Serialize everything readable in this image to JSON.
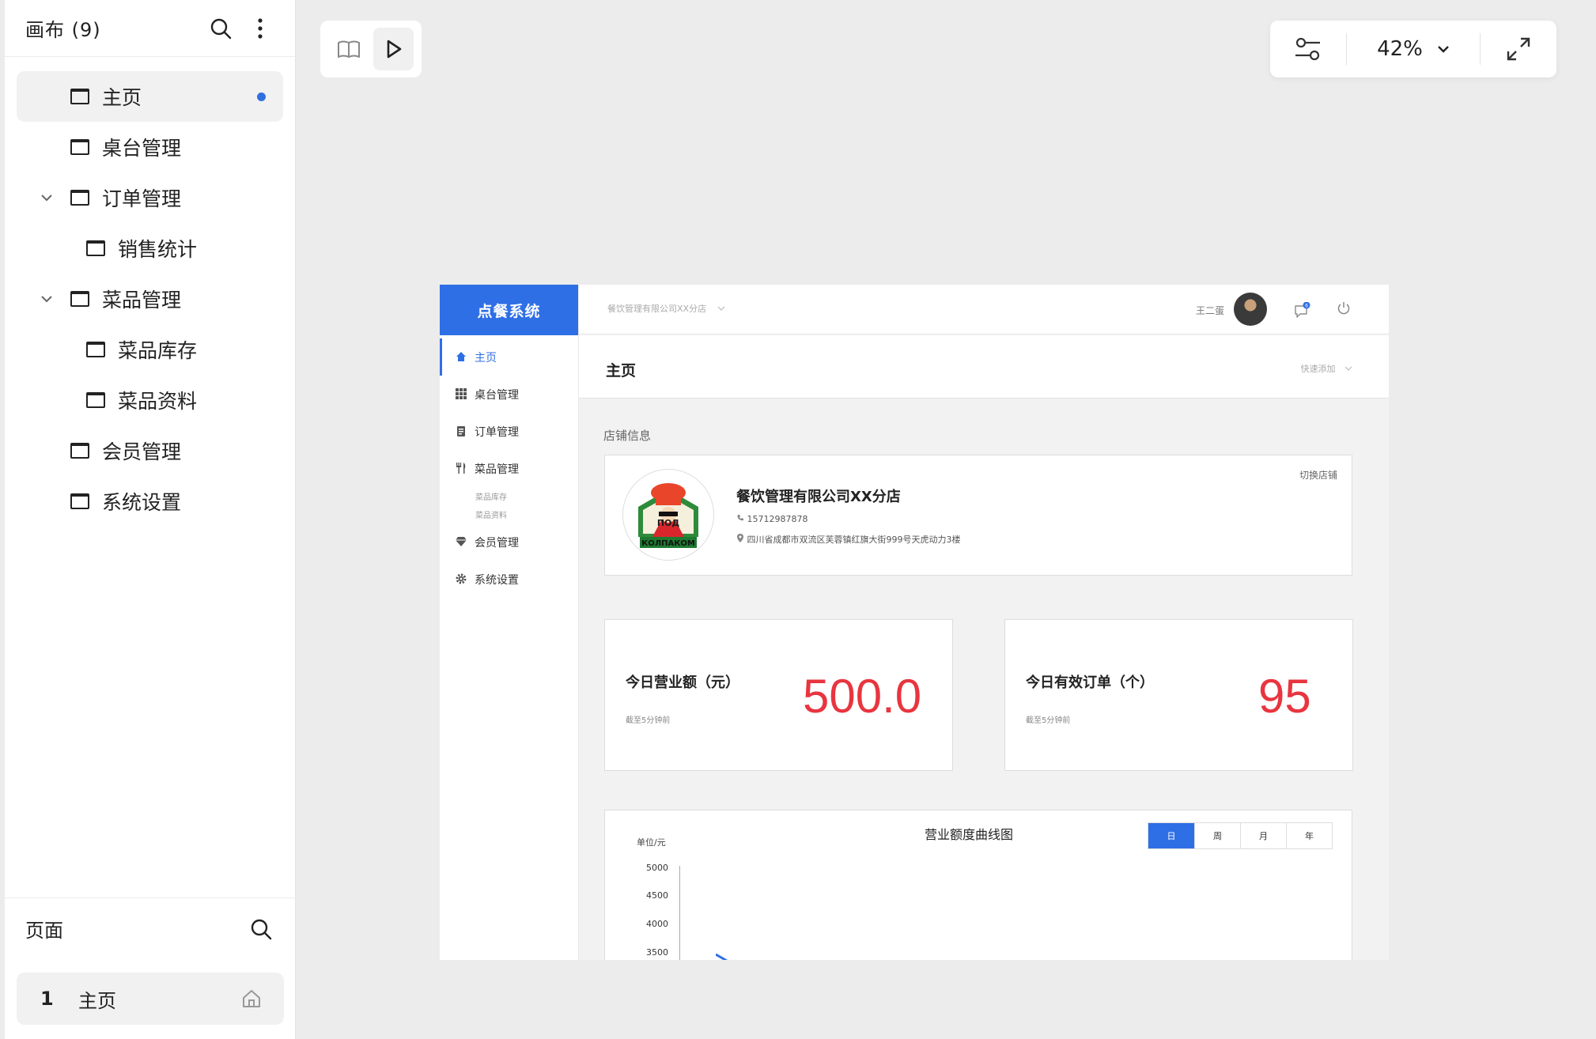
{
  "sidebar": {
    "title": "画布 (9)",
    "tree": [
      {
        "label": "主页",
        "depth": 0,
        "active": true,
        "expandable": false
      },
      {
        "label": "桌台管理",
        "depth": 0,
        "active": false,
        "expandable": false
      },
      {
        "label": "订单管理",
        "depth": 0,
        "active": false,
        "expandable": true
      },
      {
        "label": "销售统计",
        "depth": 1,
        "active": false,
        "expandable": false
      },
      {
        "label": "菜品管理",
        "depth": 0,
        "active": false,
        "expandable": true
      },
      {
        "label": "菜品库存",
        "depth": 1,
        "active": false,
        "expandable": false
      },
      {
        "label": "菜品资料",
        "depth": 1,
        "active": false,
        "expandable": false
      },
      {
        "label": "会员管理",
        "depth": 0,
        "active": false,
        "expandable": false
      },
      {
        "label": "系统设置",
        "depth": 0,
        "active": false,
        "expandable": false
      }
    ],
    "pages_title": "页面",
    "pages": [
      {
        "num": "1",
        "name": "主页"
      }
    ]
  },
  "toolbar": {
    "zoom": "42%"
  },
  "artboard": {
    "brand": "点餐系统",
    "store_select": "餐饮管理有限公司XX分店",
    "user_name": "王二蛋",
    "msg_badge": "6",
    "nav": [
      {
        "label": "主页",
        "icon": "home-icon",
        "active": true
      },
      {
        "label": "桌台管理",
        "icon": "grid-icon",
        "active": false
      },
      {
        "label": "订单管理",
        "icon": "clipboard-icon",
        "active": false
      },
      {
        "label": "菜品管理",
        "icon": "fork-knife-icon",
        "active": false
      },
      {
        "label": "会员管理",
        "icon": "diamond-icon",
        "active": false
      },
      {
        "label": "系统设置",
        "icon": "gear-icon",
        "active": false
      }
    ],
    "nav_sub": [
      "菜品库存",
      "菜品资料"
    ],
    "page_title": "主页",
    "quick_add": "快速添加",
    "section_title": "店铺信息",
    "store": {
      "name": "餐饮管理有限公司XX分店",
      "phone": "15712987878",
      "address": "四川省成都市双流区芙蓉镇红旗大街999号天虎动力3楼",
      "switch": "切换店铺",
      "logo_text": "под колпаком"
    },
    "stats": [
      {
        "label": "今日营业额（元）",
        "note": "截至5分钟前",
        "value": "500.0"
      },
      {
        "label": "今日有效订单（个）",
        "note": "截至5分钟前",
        "value": "95"
      }
    ],
    "chart": {
      "title": "营业额度曲线图",
      "unit": "单位/元",
      "ranges": [
        "日",
        "周",
        "月",
        "年"
      ],
      "active_range": "日",
      "yticks": [
        "5000",
        "4500",
        "4000",
        "3500"
      ]
    }
  },
  "colors": {
    "accent": "#2f6fe6",
    "value_red": "#e8353f",
    "active_dot": "#2f6fe0"
  }
}
